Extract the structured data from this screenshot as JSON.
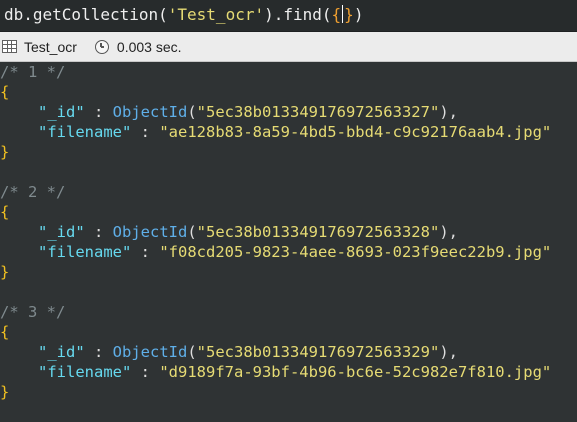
{
  "query": {
    "prefix": "db.getCollection(",
    "collection": "'Test_ocr'",
    "middle": ").find(",
    "open_brace": "{",
    "close_brace": "}",
    "suffix": ")"
  },
  "tab_bar": {
    "collection_name": "Test_ocr",
    "elapsed": "0.003 sec.",
    "icons": [
      "table-icon",
      "clock-icon"
    ]
  },
  "results": [
    {
      "comment": "/* 1 */",
      "id_key": "\"_id\"",
      "id_fn": "ObjectId",
      "id_value": "\"5ec38b013349176972563327\"",
      "filename_key": "\"filename\"",
      "filename_value": "\"ae128b83-8a59-4bd5-bbd4-c9c92176aab4.jpg\""
    },
    {
      "comment": "/* 2 */",
      "id_key": "\"_id\"",
      "id_fn": "ObjectId",
      "id_value": "\"5ec38b013349176972563328\"",
      "filename_key": "\"filename\"",
      "filename_value": "\"f08cd205-9823-4aee-8693-023f9eec22b9.jpg\""
    },
    {
      "comment": "/* 3 */",
      "id_key": "\"_id\"",
      "id_fn": "ObjectId",
      "id_value": "\"5ec38b013349176972563329\"",
      "filename_key": "\"filename\"",
      "filename_value": "\"d9189f7a-93bf-4b96-bc6e-52c982e7f810.jpg\""
    }
  ],
  "colors": {
    "background": "#2f3334",
    "comment": "#7f8a8e",
    "brace": "#f0c020",
    "key": "#66d9ef",
    "string": "#e6db74",
    "function": "#5fafe8"
  }
}
